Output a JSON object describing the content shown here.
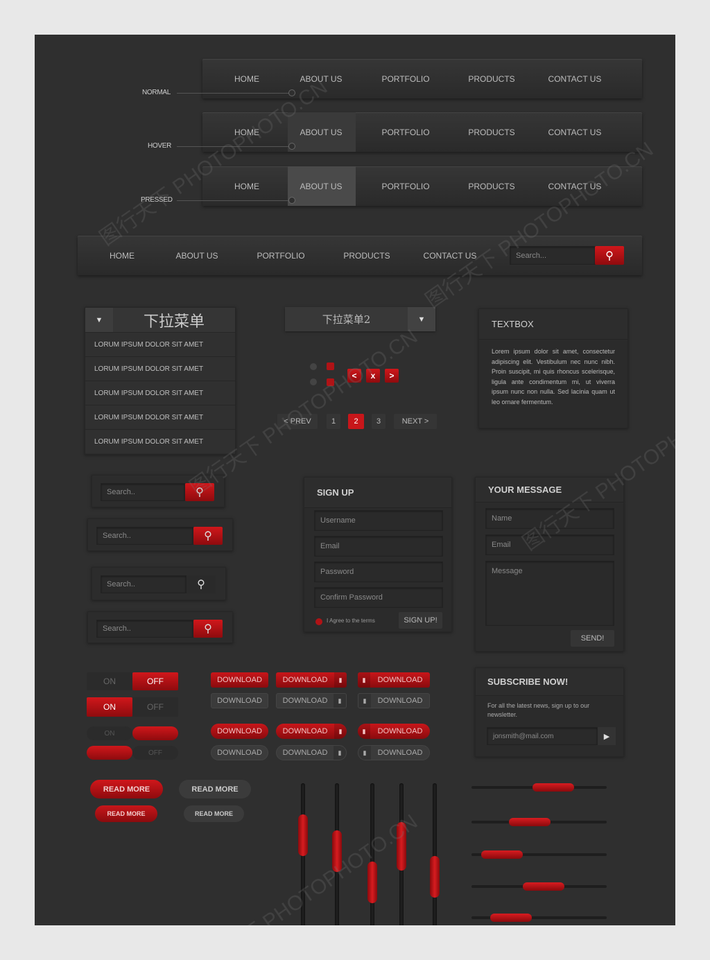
{
  "nav": {
    "items": [
      "HOME",
      "ABOUT US",
      "PORTFOLIO",
      "PRODUCTS",
      "CONTACT US"
    ],
    "states": [
      "NORMAL",
      "HOVER",
      "PRESSED"
    ],
    "search_placeholder": "Search..."
  },
  "dropdown1": {
    "title": "下拉菜单",
    "items": [
      "LORUM IPSUM DOLOR SIT AMET",
      "LORUM IPSUM DOLOR SIT AMET",
      "LORUM IPSUM DOLOR SIT AMET",
      "LORUM IPSUM DOLOR SIT AMET",
      "LORUM IPSUM DOLOR SIT AMET"
    ]
  },
  "dropdown2": {
    "title": "下拉菜单2"
  },
  "pagination": {
    "prev": "< PREV",
    "pages": [
      "1",
      "2",
      "3"
    ],
    "current": "2",
    "next": "NEXT >"
  },
  "arrows": {
    "left": "<",
    "close": "x",
    "right": ">"
  },
  "textbox": {
    "title": "TEXTBOX",
    "body": "Lorem ipsum dolor sit amet, consectetur adipiscing elit. Vestibulum nec nunc nibh. Proin suscipit, mi quis rhoncus scelerisque, ligula ante condimentum mi, ut viverra ipsum nunc non nulla. Sed lacinia quam ut leo ornare fermentum."
  },
  "search": {
    "placeholder": "Search.."
  },
  "signup": {
    "title": "SIGN UP",
    "fields": [
      "Username",
      "Email",
      "Password",
      "Confirm Password"
    ],
    "agree": "I Agree to the terms",
    "button": "SIGN UP!"
  },
  "message": {
    "title": "YOUR MESSAGE",
    "name": "Name",
    "email": "Email",
    "message": "Message",
    "button": "SEND!"
  },
  "subscribe": {
    "title": "SUBSCRIBE NOW!",
    "text": "For all the latest news, sign up to our newsletter.",
    "email": "jonsmith@mail.com"
  },
  "toggles": {
    "on": "ON",
    "off": "OFF"
  },
  "download": {
    "label": "DOWNLOAD"
  },
  "readmore": {
    "label": "READ MORE"
  },
  "sliders": {
    "vertical": [
      0.7,
      0.55,
      0.25,
      0.6,
      0.3
    ],
    "horizontal": [
      0.65,
      0.4,
      0.1,
      0.55,
      0.2
    ]
  },
  "colors": {
    "accent": "#c8161a",
    "background": "#2f2f2f"
  }
}
